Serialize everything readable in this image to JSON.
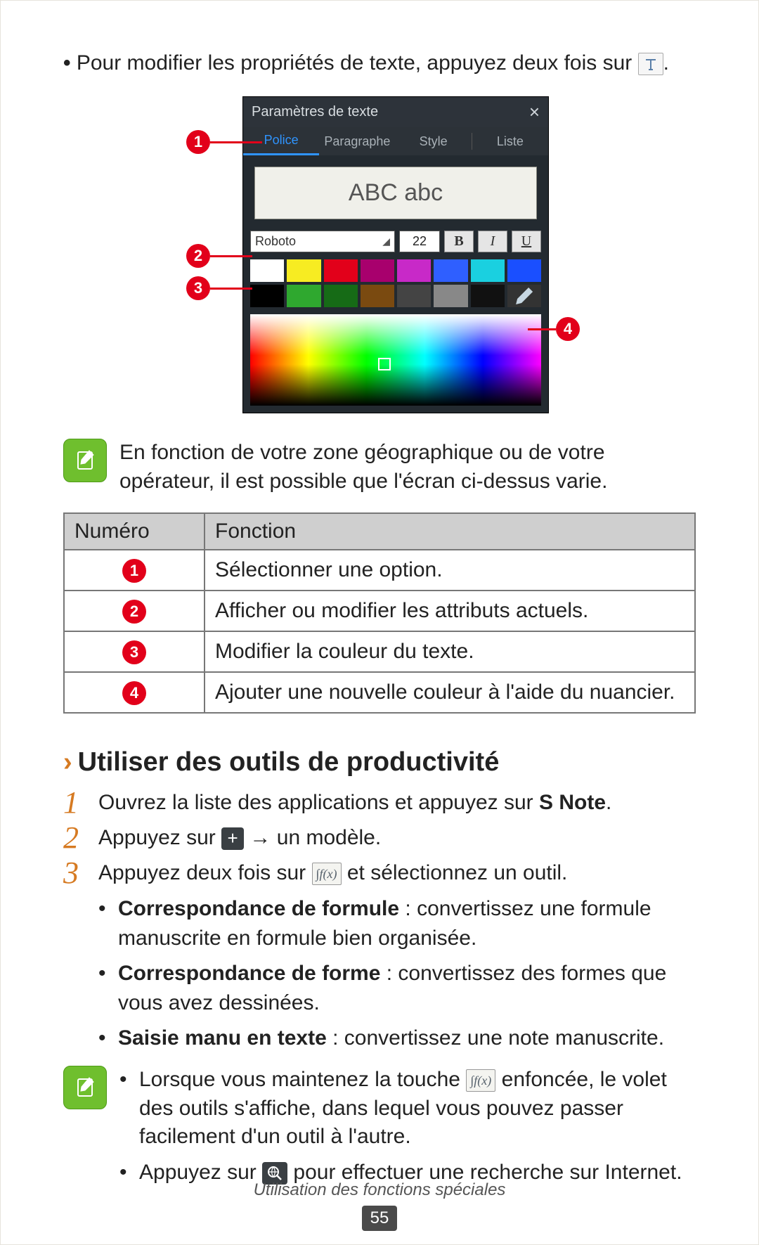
{
  "intro": {
    "text_before_icon": "Pour modifier les propriétés de texte, appuyez deux fois sur ",
    "text_after_icon": "."
  },
  "panel": {
    "title": "Paramètres de texte",
    "tabs": [
      "Police",
      "Paragraphe",
      "Style",
      "Liste"
    ],
    "preview": "ABC abc",
    "font": "Roboto",
    "size": "22",
    "buttons": {
      "bold": "B",
      "italic": "I",
      "underline": "U"
    },
    "swatches": [
      "#ffffff",
      "#f7ec22",
      "#e2001a",
      "#a8006d",
      "#c829c8",
      "#2f5fff",
      "#1ad0e0",
      "#1a4fff",
      "#000000",
      "#2fa82f",
      "#166b16",
      "#7a4a10",
      "#444444",
      "#888888",
      "#111111",
      "picker"
    ]
  },
  "note1": "En fonction de votre zone géographique ou de votre opérateur, il est possible que l'écran ci-dessus varie.",
  "table": {
    "headers": [
      "Numéro",
      "Fonction"
    ],
    "rows": [
      {
        "n": "1",
        "f": "Sélectionner une option."
      },
      {
        "n": "2",
        "f": "Afficher ou modifier les attributs actuels."
      },
      {
        "n": "3",
        "f": "Modifier la couleur du texte."
      },
      {
        "n": "4",
        "f": "Ajouter une nouvelle couleur à l'aide du nuancier."
      }
    ]
  },
  "section": {
    "title": "Utiliser des outils de productivité"
  },
  "steps": {
    "s1_a": "Ouvrez la liste des applications et appuyez sur ",
    "s1_bold": "S Note",
    "s1_b": ".",
    "s2_a": "Appuyez sur ",
    "s2_b": " → un modèle.",
    "s3_a": "Appuyez deux fois sur ",
    "s3_b": " et sélectionnez un outil."
  },
  "tools": [
    {
      "b": "Correspondance de formule",
      "t": " : convertissez une formule manuscrite en formule bien organisée."
    },
    {
      "b": "Correspondance de forme",
      "t": " : convertissez des formes que vous avez dessinées."
    },
    {
      "b": "Saisie manu en texte",
      "t": " : convertissez une note manuscrite."
    }
  ],
  "note2": {
    "l1a": "Lorsque vous maintenez la touche ",
    "l1b": " enfoncée, le volet des outils s'affiche, dans lequel vous pouvez passer facilement d'un outil à l'autre.",
    "l2a": "Appuyez sur ",
    "l2b": " pour effectuer une recherche sur Internet."
  },
  "footer": "Utilisation des fonctions spéciales",
  "pagenum": "55"
}
